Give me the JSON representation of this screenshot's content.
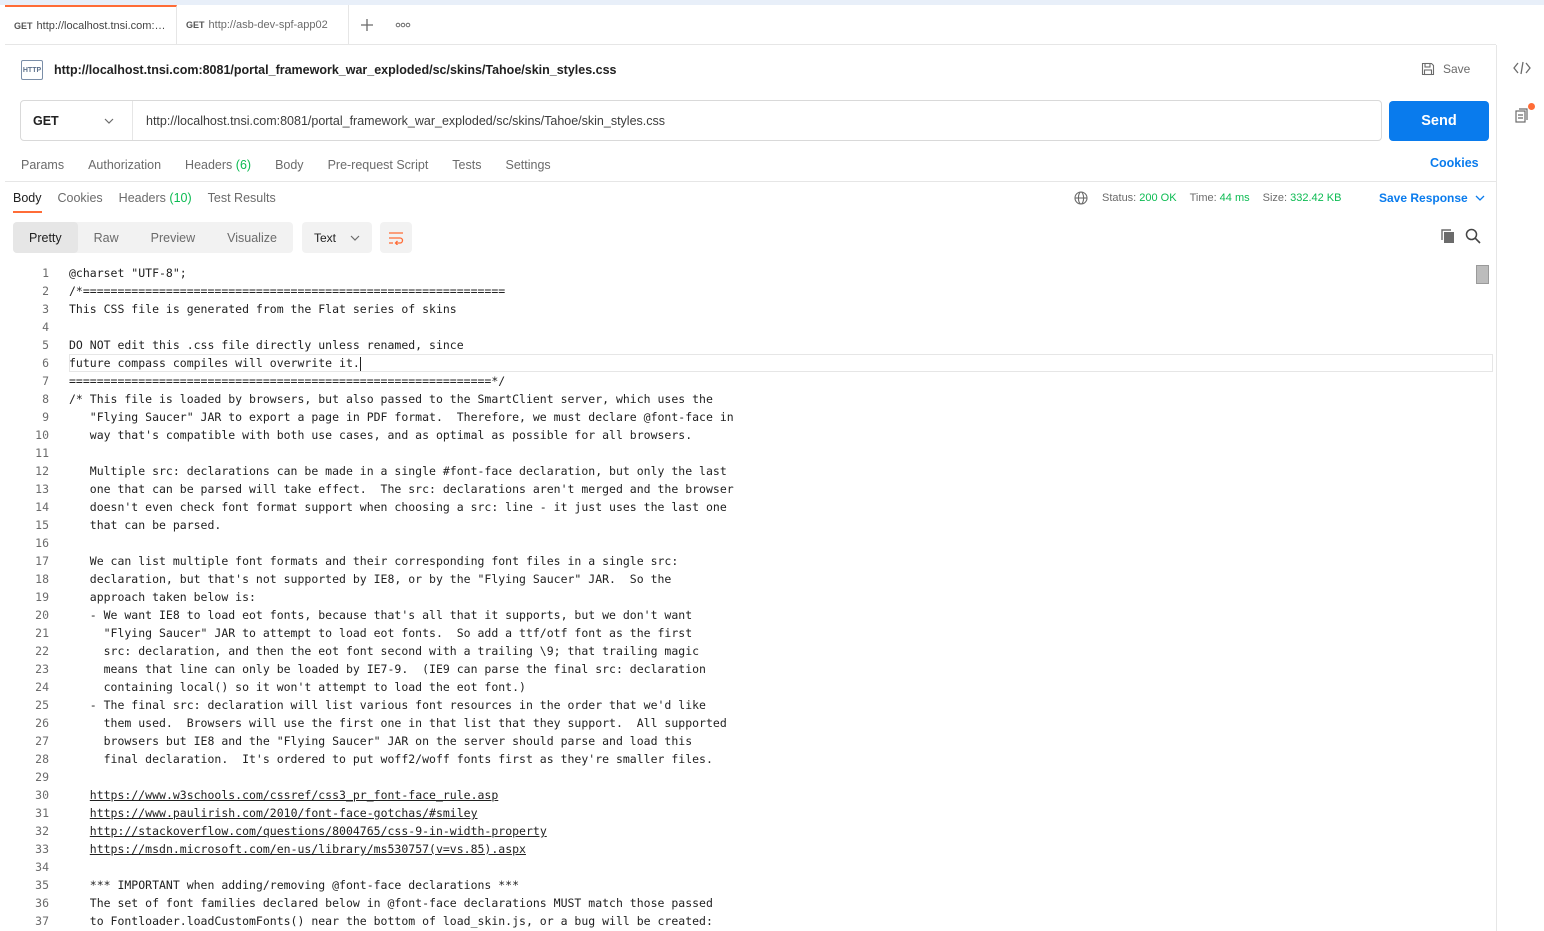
{
  "tabs": [
    {
      "method": "GET",
      "url": "http://localhost.tnsi.com:8081/portal_framework_war_exploded/sc/skins/Tahoe/skin_styles.css"
    },
    {
      "method": "GET",
      "url": "http://asb-dev-spf-app02"
    }
  ],
  "request": {
    "title": "http://localhost.tnsi.com:8081/portal_framework_war_exploded/sc/skins/Tahoe/skin_styles.css",
    "http_badge": "HTTP",
    "save_label": "Save",
    "method": "GET",
    "url": "http://localhost.tnsi.com:8081/portal_framework_war_exploded/sc/skins/Tahoe/skin_styles.css",
    "send_label": "Send"
  },
  "request_tabs": {
    "params": "Params",
    "authorization": "Authorization",
    "headers": "Headers",
    "headers_count": "(6)",
    "body": "Body",
    "prerequest": "Pre-request Script",
    "tests": "Tests",
    "settings": "Settings",
    "cookies": "Cookies"
  },
  "response_tabs": {
    "body": "Body",
    "cookies": "Cookies",
    "headers": "Headers",
    "headers_count": "(10)",
    "test_results": "Test Results"
  },
  "response_status": {
    "status_label": "Status:",
    "status_value": "200 OK",
    "time_label": "Time:",
    "time_value": "44 ms",
    "size_label": "Size:",
    "size_value": "332.42 KB",
    "save_response": "Save Response"
  },
  "view_modes": {
    "pretty": "Pretty",
    "raw": "Raw",
    "preview": "Preview",
    "visualize": "Visualize",
    "format": "Text"
  },
  "colors": {
    "accent": "#ff6c37",
    "primary": "#097bed",
    "success": "#0cbb52"
  },
  "code_lines": [
    "@charset \"UTF-8\";",
    "/*=============================================================",
    "This CSS file is generated from the Flat series of skins",
    "",
    "DO NOT edit this .css file directly unless renamed, since",
    "future compass compiles will overwrite it.",
    "=============================================================*/",
    "/* This file is loaded by browsers, but also passed to the SmartClient server, which uses the",
    "   \"Flying Saucer\" JAR to export a page in PDF format.  Therefore, we must declare @font-face in",
    "   way that's compatible with both use cases, and as optimal as possible for all browsers.",
    "",
    "   Multiple src: declarations can be made in a single #font-face declaration, but only the last",
    "   one that can be parsed will take effect.  The src: declarations aren't merged and the browser",
    "   doesn't even check font format support when choosing a src: line - it just uses the last one",
    "   that can be parsed.",
    "",
    "   We can list multiple font formats and their corresponding font files in a single src:",
    "   declaration, but that's not supported by IE8, or by the \"Flying Saucer\" JAR.  So the",
    "   approach taken below is:",
    "   - We want IE8 to load eot fonts, because that's all that it supports, but we don't want",
    "     \"Flying Saucer\" JAR to attempt to load eot fonts.  So add a ttf/otf font as the first",
    "     src: declaration, and then the eot font second with a trailing \\9; that trailing magic",
    "     means that line can only be loaded by IE7-9.  (IE9 can parse the final src: declaration",
    "     containing local() so it won't attempt to load the eot font.)",
    "   - The final src: declaration will list various font resources in the order that we'd like",
    "     them used.  Browsers will use the first one in that list that they support.  All supported",
    "     browsers but IE8 and the \"Flying Saucer\" JAR on the server should parse and load this",
    "     final declaration.  It's ordered to put woff2/woff fonts first as they're smaller files.",
    "",
    "   https://www.w3schools.com/cssref/css3_pr_font-face_rule.asp",
    "   https://www.paulirish.com/2010/font-face-gotchas/#smiley",
    "   http://stackoverflow.com/questions/8004765/css-9-in-width-property",
    "   https://msdn.microsoft.com/en-us/library/ms530757(v=vs.85).aspx",
    "",
    "   *** IMPORTANT when adding/removing @font-face declarations ***",
    "   The set of font families declared below in @font-face declarations MUST match those passed",
    "   to Fontloader.loadCustomFonts() near the bottom of load_skin.js, or a bug will be created:"
  ],
  "link_lines": [
    30,
    31,
    32,
    33
  ],
  "cursor_line": 6
}
